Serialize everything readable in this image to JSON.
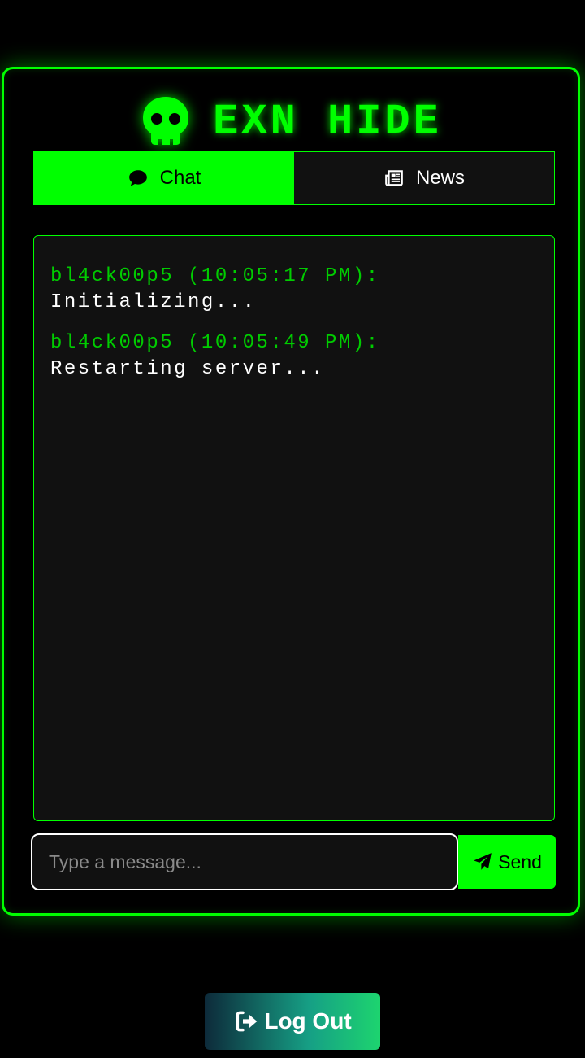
{
  "app": {
    "title": "EXN HIDE",
    "accent_color": "#00ff00",
    "logo_icon": "skull-icon"
  },
  "tabs": [
    {
      "label": "Chat",
      "icon": "comment-icon",
      "active": true
    },
    {
      "label": "News",
      "icon": "newspaper-icon",
      "active": false
    }
  ],
  "messages": [
    {
      "header": "bl4ck00p5 (10:05:17 PM):",
      "body": "Initializing..."
    },
    {
      "header": "bl4ck00p5 (10:05:49 PM):",
      "body": "Restarting server..."
    }
  ],
  "composer": {
    "placeholder": "Type a message...",
    "value": "",
    "send_label": "Send",
    "send_icon": "paper-plane-icon"
  },
  "logout": {
    "label": "Log Out",
    "icon": "sign-out-icon"
  }
}
